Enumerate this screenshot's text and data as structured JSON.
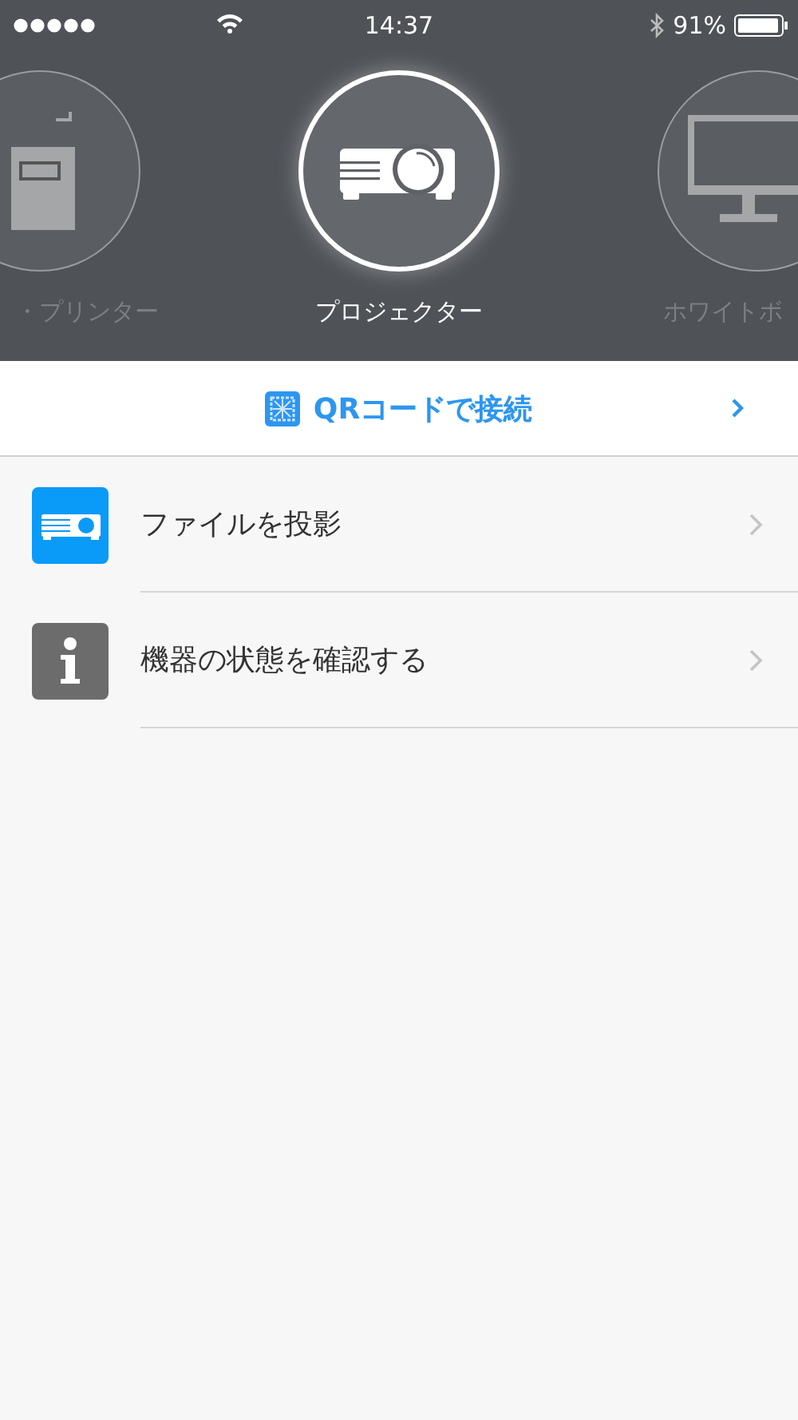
{
  "status_bar": {
    "time": "14:37",
    "battery": "91%"
  },
  "devices": [
    {
      "kind": "printer",
      "label": "・プリンター",
      "selected": false
    },
    {
      "kind": "projector",
      "label": "プロジェクター",
      "selected": true
    },
    {
      "kind": "whiteboard",
      "label": "ホワイトボ",
      "selected": false
    }
  ],
  "qr_button": {
    "label": "QRコードで接続"
  },
  "menu": [
    {
      "kind": "projector",
      "label": "ファイルを投影"
    },
    {
      "kind": "info",
      "label": "機器の状態を確認する"
    }
  ]
}
